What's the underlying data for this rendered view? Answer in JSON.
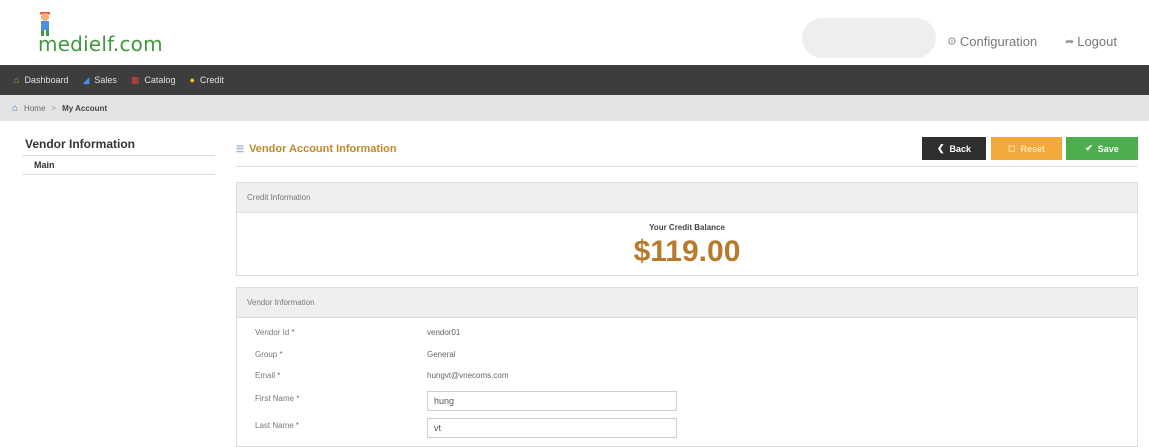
{
  "header": {
    "logo_text": "medielf.com",
    "configuration_label": "Configuration",
    "logout_label": "Logout"
  },
  "nav": {
    "items": [
      {
        "label": "Dashboard",
        "icon": "home-icon",
        "color": "#f0a030"
      },
      {
        "label": "Sales",
        "icon": "chart-icon",
        "color": "#4a90e2"
      },
      {
        "label": "Catalog",
        "icon": "grid-icon",
        "color": "#e04040"
      },
      {
        "label": "Credit",
        "icon": "coin-icon",
        "color": "#f5c518"
      }
    ]
  },
  "breadcrumb": {
    "home": "Home",
    "current": "My Account"
  },
  "sidebar": {
    "title": "Vendor Information",
    "items": [
      {
        "label": "Main"
      }
    ]
  },
  "main": {
    "title": "Vendor Account Information",
    "buttons": {
      "back": "Back",
      "reset": "Reset",
      "save": "Save"
    }
  },
  "credit_panel": {
    "heading": "Credit Information",
    "balance_label": "Your Credit Balance",
    "balance_value": "$119.00"
  },
  "vendor_panel": {
    "heading": "Vendor Information",
    "fields": {
      "vendor_id": {
        "label": "Vendor Id *",
        "value": "vendor01"
      },
      "group": {
        "label": "Group *",
        "value": "General"
      },
      "email": {
        "label": "Email *",
        "value": "hungvt@vnecoms.com"
      },
      "first_name": {
        "label": "First Name *",
        "value": "hung"
      },
      "last_name": {
        "label": "Last Name *",
        "value": "vt"
      }
    }
  },
  "colors": {
    "accent": "#c08a2c",
    "nav_bg": "#3d3d3d",
    "save": "#4cae4c",
    "reset": "#f2a93b",
    "back": "#2f2f2f",
    "logo": "#3f9a3d"
  }
}
